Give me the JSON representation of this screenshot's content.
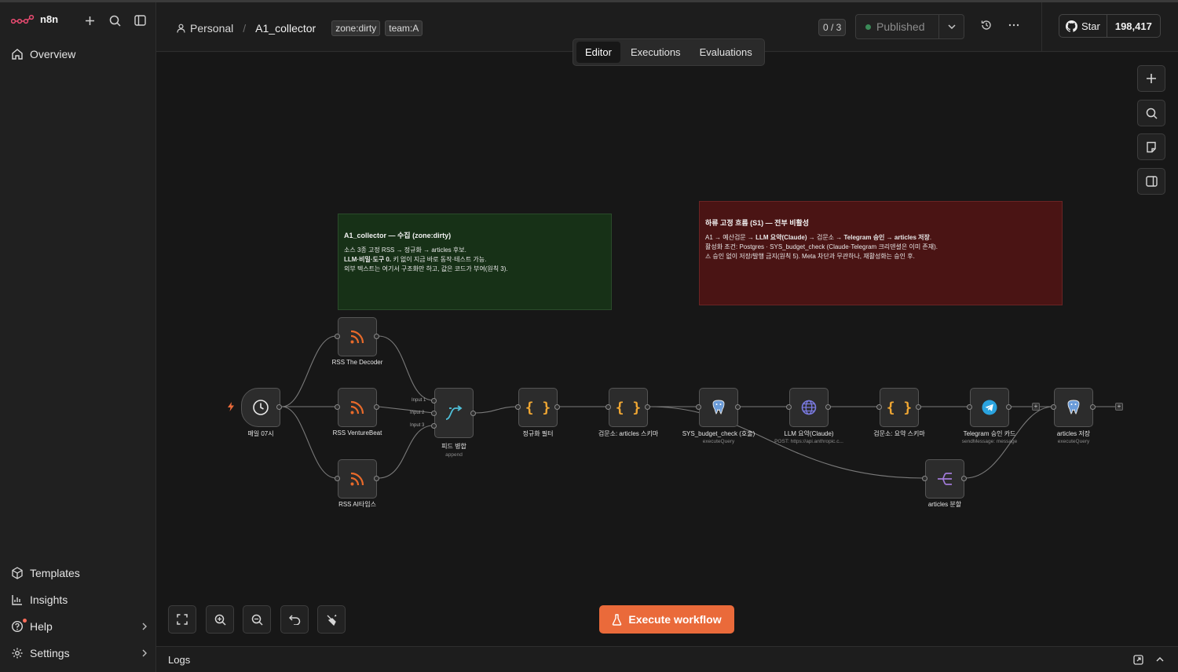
{
  "app": {
    "brand": "n8n"
  },
  "sidebar": {
    "overview": "Overview",
    "templates": "Templates",
    "insights": "Insights",
    "help": "Help",
    "settings": "Settings"
  },
  "header": {
    "project": "Personal",
    "workflow": "A1_collector",
    "tags": [
      "zone:dirty",
      "team:A"
    ],
    "counter": "0 / 3",
    "published": "Published",
    "github_star": "Star",
    "github_count": "198,417"
  },
  "tabs": {
    "editor": "Editor",
    "executions": "Executions",
    "evaluations": "Evaluations"
  },
  "notes": {
    "green": {
      "title": "A1_collector — 수집 (zone:dirty)",
      "line1": "소스 3종 고정 RSS → 정규화 → articles 후보.",
      "line2_bold": "LLM·비밀·도구 0.",
      "line2_rest": " 키 없이 지금 바로 동작·테스트 가능.",
      "line3": "외부 텍스트는 여기서 구조화만 하고, 값은 코드가 부여(원칙 3)."
    },
    "red": {
      "title": "하류 고정 흐름 (S1) — 전부 비활성",
      "l1_a": "A1 → 예산검문 → ",
      "l1_b": "LLM 요약(Claude)",
      "l1_c": " → 검문소 → ",
      "l1_d": "Telegram 승인",
      "l1_e": " → ",
      "l1_f": "articles 저장",
      "l1_g": ".",
      "line2": "활성화 조건: Postgres · SYS_budget_check (Claude·Telegram 크리덴셜은 이미 존재).",
      "line3": "⚠ 승인 없이 저장/발행 금지(원칙 5). Meta 차단과 무관하나, 재활성화는 승인 후."
    }
  },
  "nodes": {
    "trigger": {
      "label": "매일 07시"
    },
    "rss1": {
      "label": "RSS The Decoder"
    },
    "rss2": {
      "label": "RSS VentureBeat"
    },
    "rss3": {
      "label": "RSS AI타임스"
    },
    "merge": {
      "label": "피드 병합",
      "sub": "append",
      "in1": "Input 1",
      "in2": "Input 2",
      "in3": "Input 3"
    },
    "normalize": {
      "label": "정규화 필터"
    },
    "check1": {
      "label": "검문소: articles 스키마"
    },
    "budget": {
      "label": "SYS_budget_check (호출)",
      "sub": "executeQuery"
    },
    "llm": {
      "label": "LLM 요약(Claude)",
      "sub": "POST: https://api.anthropic.c..."
    },
    "check2": {
      "label": "검문소: 요약 스키마"
    },
    "telegram": {
      "label": "Telegram 승인 카드",
      "sub": "sendMessage: message"
    },
    "save": {
      "label": "articles 저장",
      "sub": "executeQuery"
    },
    "split": {
      "label": "articles 분할"
    }
  },
  "canvas": {
    "execute": "Execute workflow"
  },
  "logs": {
    "title": "Logs"
  },
  "colors": {
    "accent": "#ea6a3a",
    "rss": "#e86a2a",
    "code": "#f0a733",
    "postgres": "#6a9bd8",
    "telegram": "#2aa3df",
    "http": "#7a7ae0",
    "split": "#a07ad8"
  }
}
